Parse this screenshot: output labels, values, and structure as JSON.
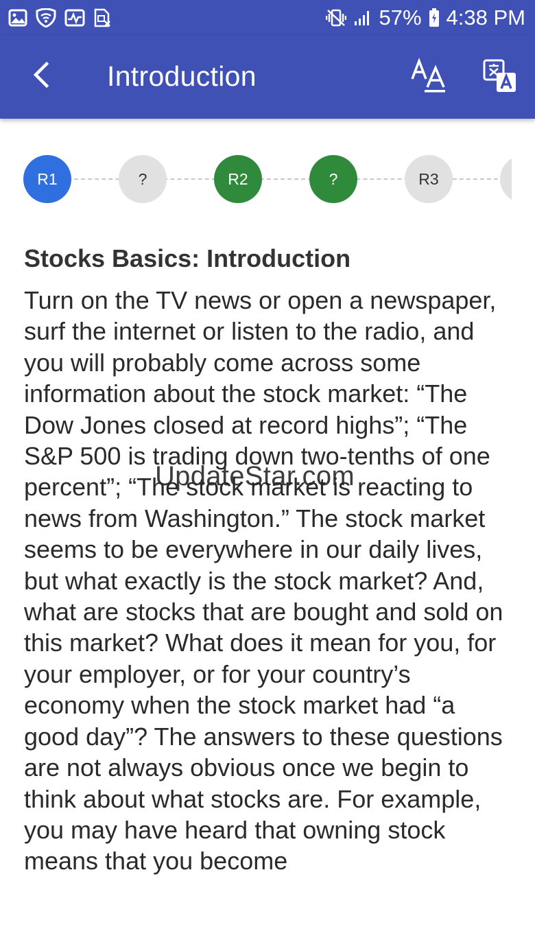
{
  "status_bar": {
    "battery_percent": "57%",
    "time": "4:38 PM",
    "left_icons": [
      "gallery-icon",
      "wifi-shield-icon",
      "activity-icon",
      "sim-icon"
    ],
    "right_icons": [
      "vibrate-icon",
      "signal-icon",
      "battery-icon"
    ]
  },
  "app_bar": {
    "title": "Introduction",
    "back_icon": "chevron-left-icon",
    "font_size_icon": "font-size-icon",
    "translate_icon": "translate-icon"
  },
  "progress_steps": [
    {
      "label": "R1",
      "state": "current"
    },
    {
      "label": "?",
      "state": "todo"
    },
    {
      "label": "R2",
      "state": "done"
    },
    {
      "label": "?",
      "state": "done"
    },
    {
      "label": "R3",
      "state": "todo"
    },
    {
      "label": "",
      "state": "todo"
    }
  ],
  "article": {
    "heading": "Stocks Basics: Introduction",
    "body": "Turn on the TV news or open a newspaper, surf the internet or listen to the radio, and you will probably come across some information about the stock market: “The Dow Jones closed at record highs”; “The S&P 500 is trading down two-tenths of one percent”; “The stock market is reacting to news from Washington.” The stock market seems to be everywhere in our daily lives, but what exactly is the stock market? And, what are stocks that are bought and sold on this market? What does it mean for you, for your employer, or for your country’s economy when the stock market had “a good day”? The answers to these questions are not always obvious once we begin to think about what stocks are. For example, you may have heard that owning stock means that you become"
  },
  "watermark": "UpdateStar.com",
  "colors": {
    "primary": "#3f51b5",
    "current_step": "#2f6fe0",
    "done_step": "#2f8a3c",
    "todo_step": "#e1e1e1"
  }
}
